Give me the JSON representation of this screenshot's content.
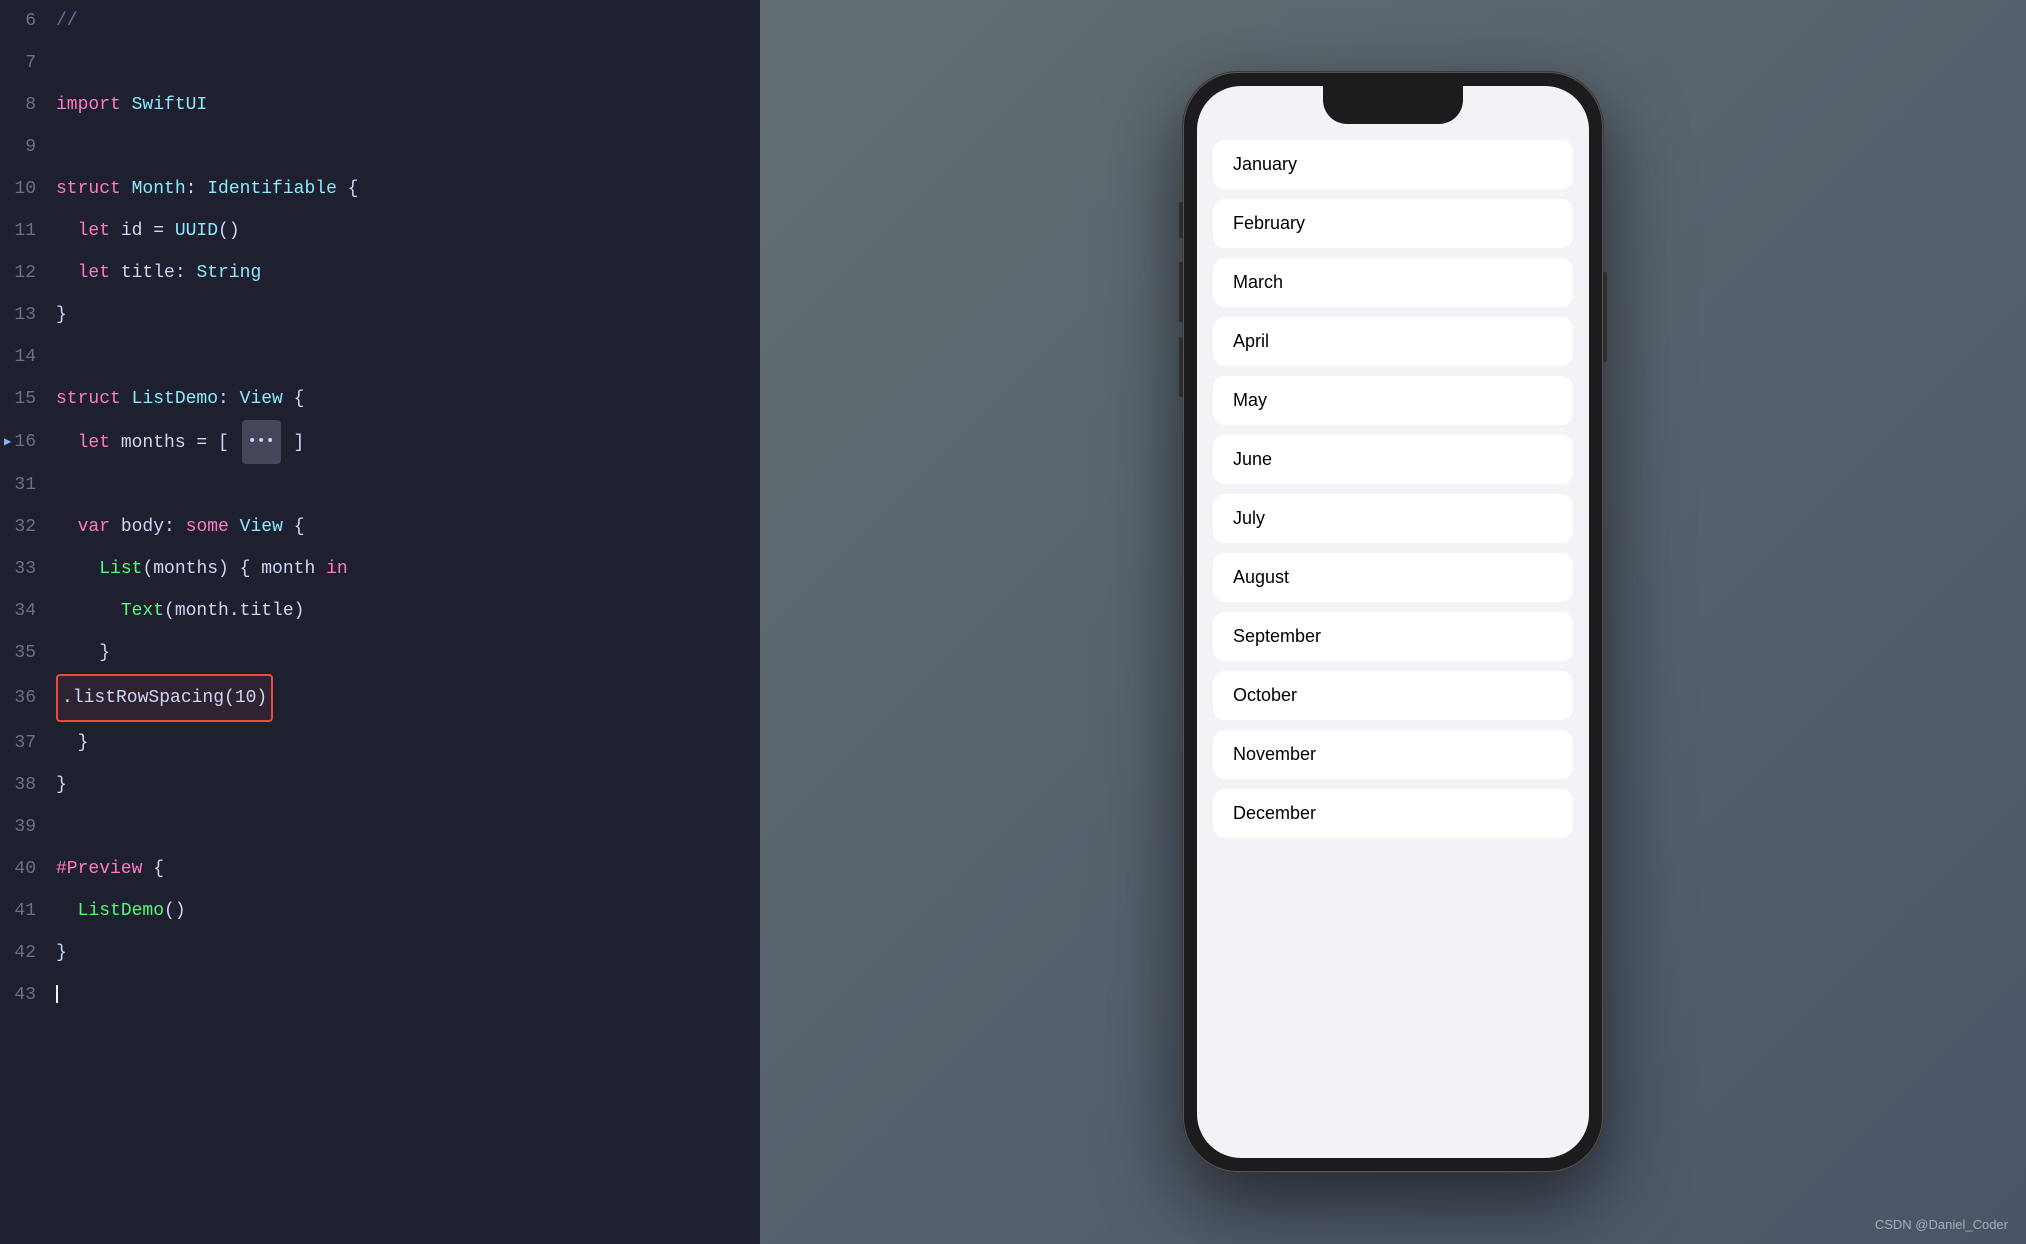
{
  "editor": {
    "lines": [
      {
        "num": 6,
        "tokens": [
          {
            "t": "comment",
            "v": "//"
          }
        ]
      },
      {
        "num": 7,
        "tokens": []
      },
      {
        "num": 8,
        "tokens": [
          {
            "t": "kw",
            "v": "import"
          },
          {
            "t": "plain",
            "v": " "
          },
          {
            "t": "type",
            "v": "SwiftUI"
          }
        ]
      },
      {
        "num": 9,
        "tokens": []
      },
      {
        "num": 10,
        "tokens": [
          {
            "t": "kw",
            "v": "struct"
          },
          {
            "t": "plain",
            "v": " "
          },
          {
            "t": "type",
            "v": "Month"
          },
          {
            "t": "plain",
            "v": ": "
          },
          {
            "t": "type",
            "v": "Identifiable"
          },
          {
            "t": "plain",
            "v": " {"
          }
        ]
      },
      {
        "num": 11,
        "tokens": [
          {
            "t": "plain",
            "v": "  "
          },
          {
            "t": "kw",
            "v": "let"
          },
          {
            "t": "plain",
            "v": " id = "
          },
          {
            "t": "type",
            "v": "UUID"
          },
          {
            "t": "plain",
            "v": "()"
          }
        ]
      },
      {
        "num": 12,
        "tokens": [
          {
            "t": "plain",
            "v": "  "
          },
          {
            "t": "kw",
            "v": "let"
          },
          {
            "t": "plain",
            "v": " title: "
          },
          {
            "t": "type",
            "v": "String"
          }
        ]
      },
      {
        "num": 13,
        "tokens": [
          {
            "t": "plain",
            "v": "}"
          }
        ]
      },
      {
        "num": 14,
        "tokens": []
      },
      {
        "num": 15,
        "tokens": [
          {
            "t": "kw",
            "v": "struct"
          },
          {
            "t": "plain",
            "v": " "
          },
          {
            "t": "type",
            "v": "ListDemo"
          },
          {
            "t": "plain",
            "v": ": "
          },
          {
            "t": "type",
            "v": "View"
          },
          {
            "t": "plain",
            "v": " {"
          }
        ]
      },
      {
        "num": 16,
        "tokens": [
          {
            "t": "plain",
            "v": "  "
          },
          {
            "t": "kw",
            "v": "let"
          },
          {
            "t": "plain",
            "v": " months = [ "
          },
          {
            "t": "dots",
            "v": "•••"
          },
          {
            "t": "plain",
            "v": " ]"
          }
        ],
        "indicator": true
      },
      {
        "num": 31,
        "tokens": []
      },
      {
        "num": 32,
        "tokens": [
          {
            "t": "plain",
            "v": "  "
          },
          {
            "t": "kw",
            "v": "var"
          },
          {
            "t": "plain",
            "v": " body: "
          },
          {
            "t": "kw",
            "v": "some"
          },
          {
            "t": "plain",
            "v": " "
          },
          {
            "t": "type",
            "v": "View"
          },
          {
            "t": "plain",
            "v": " {"
          }
        ]
      },
      {
        "num": 33,
        "tokens": [
          {
            "t": "plain",
            "v": "    "
          },
          {
            "t": "func",
            "v": "List"
          },
          {
            "t": "plain",
            "v": "(months) { month "
          },
          {
            "t": "kw",
            "v": "in"
          }
        ]
      },
      {
        "num": 34,
        "tokens": [
          {
            "t": "plain",
            "v": "      "
          },
          {
            "t": "func",
            "v": "Text"
          },
          {
            "t": "plain",
            "v": "(month.title)"
          }
        ]
      },
      {
        "num": 35,
        "tokens": [
          {
            "t": "plain",
            "v": "    }"
          }
        ]
      },
      {
        "num": 36,
        "tokens": [
          {
            "t": "highlight",
            "v": ".listRowSpacing(10)"
          }
        ]
      },
      {
        "num": 37,
        "tokens": [
          {
            "t": "plain",
            "v": "  }"
          }
        ]
      },
      {
        "num": 38,
        "tokens": [
          {
            "t": "plain",
            "v": "}"
          }
        ]
      },
      {
        "num": 39,
        "tokens": []
      },
      {
        "num": 40,
        "tokens": [
          {
            "t": "kw",
            "v": "#Preview"
          },
          {
            "t": "plain",
            "v": " {"
          }
        ]
      },
      {
        "num": 41,
        "tokens": [
          {
            "t": "plain",
            "v": "  "
          },
          {
            "t": "func",
            "v": "ListDemo"
          },
          {
            "t": "plain",
            "v": "()"
          }
        ]
      },
      {
        "num": 42,
        "tokens": [
          {
            "t": "plain",
            "v": "}"
          }
        ]
      },
      {
        "num": 43,
        "tokens": [
          {
            "t": "cursor",
            "v": ""
          }
        ]
      }
    ]
  },
  "phone": {
    "months": [
      "January",
      "February",
      "March",
      "April",
      "May",
      "June",
      "July",
      "August",
      "September",
      "October",
      "November",
      "December"
    ]
  },
  "watermark": "CSDN @Daniel_Coder"
}
